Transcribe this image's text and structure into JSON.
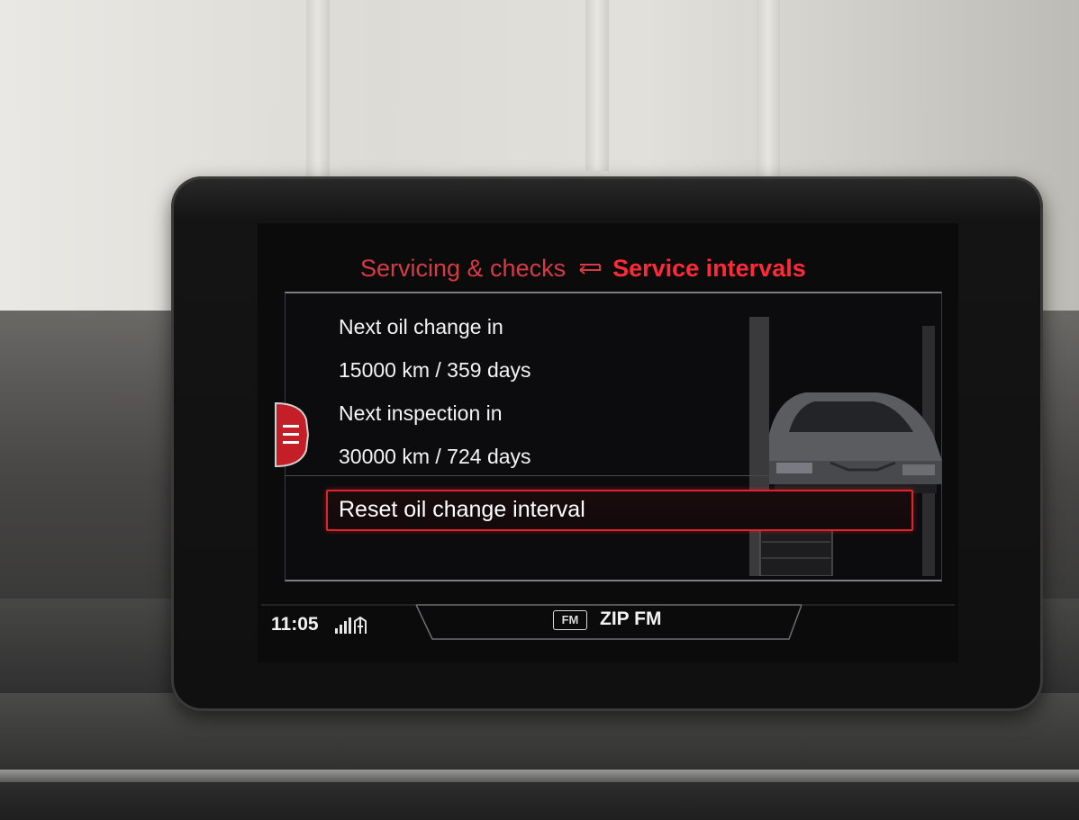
{
  "header": {
    "parent_label": "Servicing & checks",
    "back_arrow_icon": "return-arrow-icon",
    "current_label": "Service intervals"
  },
  "service": {
    "oil_change_label": "Next oil change in",
    "oil_change_value": "15000 km / 359 days",
    "inspection_label": "Next inspection in",
    "inspection_value": "30000 km / 724 days",
    "reset_option": "Reset oil change interval"
  },
  "side_menu": {
    "icon": "menu-lines-icon"
  },
  "status_bar": {
    "time": "11:05",
    "signal_icon": "signal-bars-icon",
    "source_badge": "FM",
    "station": "ZIP FM"
  },
  "colors": {
    "accent_red": "#ff2a37",
    "parent_red": "#d73a45",
    "text_white": "#f3f3f3",
    "screen_bg": "#0b0b0c"
  }
}
